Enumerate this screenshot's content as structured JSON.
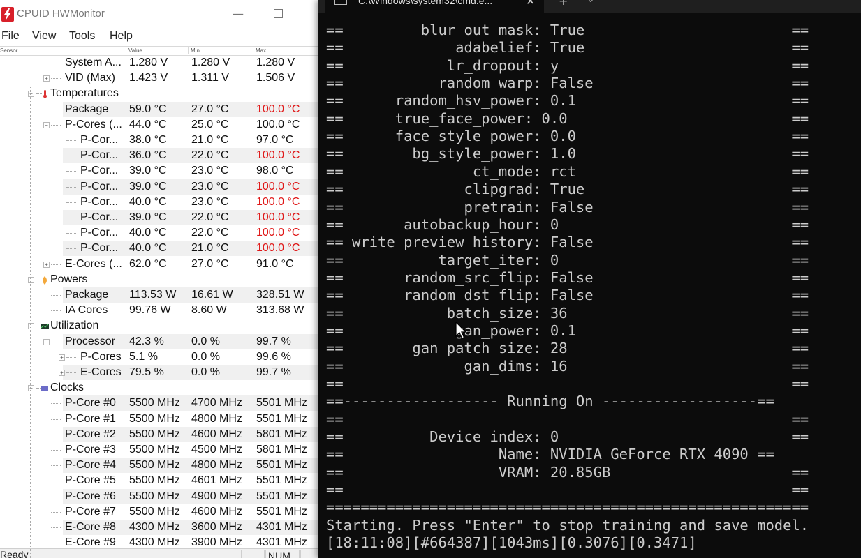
{
  "hwmonitor": {
    "title": "CPUID HWMonitor",
    "menu": [
      "File",
      "View",
      "Tools",
      "Help"
    ],
    "columns": [
      "Sensor",
      "Value",
      "Min",
      "Max"
    ],
    "rows": [
      {
        "name": "System A...",
        "value": "1.280 V",
        "min": "1.280 V",
        "max": "1.280 V",
        "hot": false
      },
      {
        "name": "VID (Max)",
        "value": "1.423 V",
        "min": "1.311 V",
        "max": "1.506 V",
        "hot": false
      },
      {
        "name": "Temperatures",
        "value": "",
        "min": "",
        "max": "",
        "hot": false
      },
      {
        "name": "Package",
        "value": "59.0 °C",
        "min": "27.0 °C",
        "max": "100.0 °C",
        "hot": true
      },
      {
        "name": "P-Cores (...",
        "value": "44.0 °C",
        "min": "25.0 °C",
        "max": "100.0 °C",
        "hot": false
      },
      {
        "name": "P-Cor...",
        "value": "38.0 °C",
        "min": "21.0 °C",
        "max": "97.0 °C",
        "hot": false
      },
      {
        "name": "P-Cor...",
        "value": "36.0 °C",
        "min": "22.0 °C",
        "max": "100.0 °C",
        "hot": true
      },
      {
        "name": "P-Cor...",
        "value": "39.0 °C",
        "min": "23.0 °C",
        "max": "98.0 °C",
        "hot": false
      },
      {
        "name": "P-Cor...",
        "value": "39.0 °C",
        "min": "23.0 °C",
        "max": "100.0 °C",
        "hot": true
      },
      {
        "name": "P-Cor...",
        "value": "40.0 °C",
        "min": "23.0 °C",
        "max": "100.0 °C",
        "hot": true
      },
      {
        "name": "P-Cor...",
        "value": "39.0 °C",
        "min": "22.0 °C",
        "max": "100.0 °C",
        "hot": true
      },
      {
        "name": "P-Cor...",
        "value": "40.0 °C",
        "min": "22.0 °C",
        "max": "100.0 °C",
        "hot": true
      },
      {
        "name": "P-Cor...",
        "value": "40.0 °C",
        "min": "21.0 °C",
        "max": "100.0 °C",
        "hot": true
      },
      {
        "name": "E-Cores (...",
        "value": "62.0 °C",
        "min": "27.0 °C",
        "max": "91.0 °C",
        "hot": false
      },
      {
        "name": "Powers",
        "value": "",
        "min": "",
        "max": "",
        "hot": false
      },
      {
        "name": "Package",
        "value": "113.53 W",
        "min": "16.61 W",
        "max": "328.51 W",
        "hot": false
      },
      {
        "name": "IA Cores",
        "value": "99.76 W",
        "min": "8.60 W",
        "max": "313.68 W",
        "hot": false
      },
      {
        "name": "Utilization",
        "value": "",
        "min": "",
        "max": "",
        "hot": false
      },
      {
        "name": "Processor",
        "value": "42.3 %",
        "min": "0.0 %",
        "max": "99.7 %",
        "hot": false
      },
      {
        "name": "P-Cores",
        "value": "5.1 %",
        "min": "0.0 %",
        "max": "99.6 %",
        "hot": false
      },
      {
        "name": "E-Cores",
        "value": "79.5 %",
        "min": "0.0 %",
        "max": "99.7 %",
        "hot": false
      },
      {
        "name": "Clocks",
        "value": "",
        "min": "",
        "max": "",
        "hot": false
      },
      {
        "name": "P-Core #0",
        "value": "5500 MHz",
        "min": "4700 MHz",
        "max": "5501 MHz",
        "hot": false
      },
      {
        "name": "P-Core #1",
        "value": "5500 MHz",
        "min": "4800 MHz",
        "max": "5501 MHz",
        "hot": false
      },
      {
        "name": "P-Core #2",
        "value": "5500 MHz",
        "min": "4600 MHz",
        "max": "5801 MHz",
        "hot": false
      },
      {
        "name": "P-Core #3",
        "value": "5500 MHz",
        "min": "4500 MHz",
        "max": "5801 MHz",
        "hot": false
      },
      {
        "name": "P-Core #4",
        "value": "5500 MHz",
        "min": "4800 MHz",
        "max": "5501 MHz",
        "hot": false
      },
      {
        "name": "P-Core #5",
        "value": "5500 MHz",
        "min": "4601 MHz",
        "max": "5501 MHz",
        "hot": false
      },
      {
        "name": "P-Core #6",
        "value": "5500 MHz",
        "min": "4900 MHz",
        "max": "5501 MHz",
        "hot": false
      },
      {
        "name": "P-Core #7",
        "value": "5500 MHz",
        "min": "4600 MHz",
        "max": "5501 MHz",
        "hot": false
      },
      {
        "name": "E-Core #8",
        "value": "4300 MHz",
        "min": "3600 MHz",
        "max": "4301 MHz",
        "hot": false
      },
      {
        "name": "E-Core #9",
        "value": "4300 MHz",
        "min": "3900 MHz",
        "max": "4301 MHz",
        "hot": false
      }
    ],
    "status": {
      "ready": "Ready",
      "num": "NUM"
    }
  },
  "terminal": {
    "tab_title": "C:\\Windows\\system32\\cmd.e...",
    "tab_close": "✕",
    "new_tab": "+",
    "dropdown": "⌄",
    "lines": [
      "==         blur_out_mask: True                        ==",
      "==             adabelief: True                        ==",
      "==            lr_dropout: y                           ==",
      "==           random_warp: False                       ==",
      "==      random_hsv_power: 0.1                         ==",
      "==      true_face_power: 0.0                          ==",
      "==      face_style_power: 0.0                         ==",
      "==        bg_style_power: 1.0                         ==",
      "==               ct_mode: rct                         ==",
      "==              clipgrad: True                        ==",
      "==              pretrain: False                       ==",
      "==       autobackup_hour: 0                           ==",
      "== write_preview_history: False                       ==",
      "==           target_iter: 0                           ==",
      "==       random_src_flip: False                       ==",
      "==       random_dst_flip: False                       ==",
      "==            batch_size: 36                          ==",
      "==             gan_power: 0.1                         ==",
      "==        gan_patch_size: 28                          ==",
      "==              gan_dims: 16                          ==",
      "==                                                    ==",
      "==------------------ Running On ------------------==",
      "==                                                    ==",
      "==          Device index: 0                           ==",
      "==                  Name: NVIDIA GeForce RTX 4090 ==",
      "==                  VRAM: 20.85GB                     ==",
      "==                                                    ==",
      "========================================================",
      "Starting. Press \"Enter\" to stop training and save model.",
      "[18:11:08][#664387][1043ms][0.3076][0.3471]"
    ]
  },
  "colors": {
    "hot": "#e01818",
    "terminal_bg": "#0c0c0c",
    "terminal_fg": "#cccccc",
    "app_icon": "#d8202a"
  }
}
